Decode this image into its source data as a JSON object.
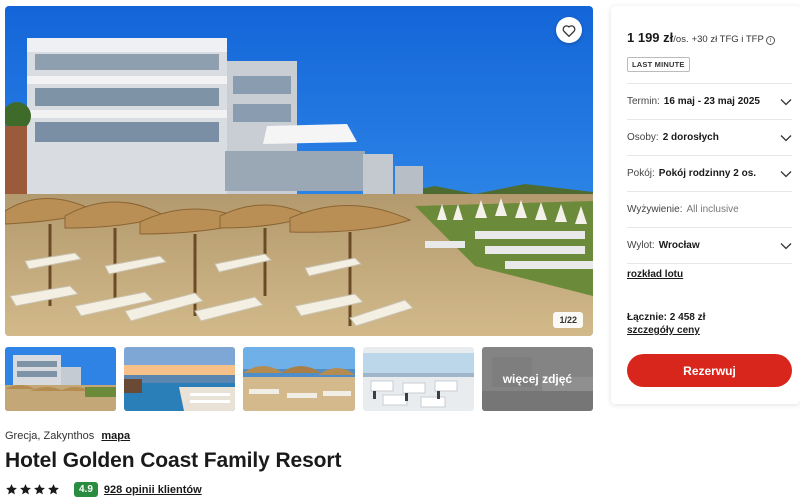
{
  "gallery": {
    "counter": "1/22",
    "more_label": "więcej zdjęć",
    "favorite_icon": "heart-icon",
    "colors": {
      "sky": "#1e7fe6",
      "sand": "#c6ac7e",
      "grass": "#6b8a3a"
    }
  },
  "location": {
    "text": "Grecja, Zakynthos",
    "map_link": "mapa"
  },
  "hotel": {
    "name": "Hotel Golden Coast Family Resort",
    "stars": 4,
    "score": "4.9",
    "reviews": "928 opinii klientów"
  },
  "booking": {
    "price": "1 199 zł",
    "price_unit": "/os.",
    "price_extra": "+30 zł TFG i TFP",
    "info_icon": "info-icon",
    "badge": "LAST MINUTE",
    "rows": [
      {
        "label": "Termin:",
        "value": "16 maj - 23 maj 2025",
        "has_chevron": true
      },
      {
        "label": "Osoby:",
        "value": "2 dorosłych",
        "has_chevron": true
      },
      {
        "label": "Pokój:",
        "value": "Pokój rodzinny 2 os.",
        "has_chevron": true
      },
      {
        "label": "Wyżywienie:",
        "value": "All inclusive",
        "has_chevron": false
      },
      {
        "label": "Wylot:",
        "value": "Wrocław",
        "has_chevron": true
      }
    ],
    "flight_schedule_link": "rozkład lotu",
    "total": "Łącznie: 2 458 zł",
    "price_details_link": "szczegóły ceny",
    "reserve_label": "Rezerwuj",
    "reserve_color": "#d8261c"
  }
}
